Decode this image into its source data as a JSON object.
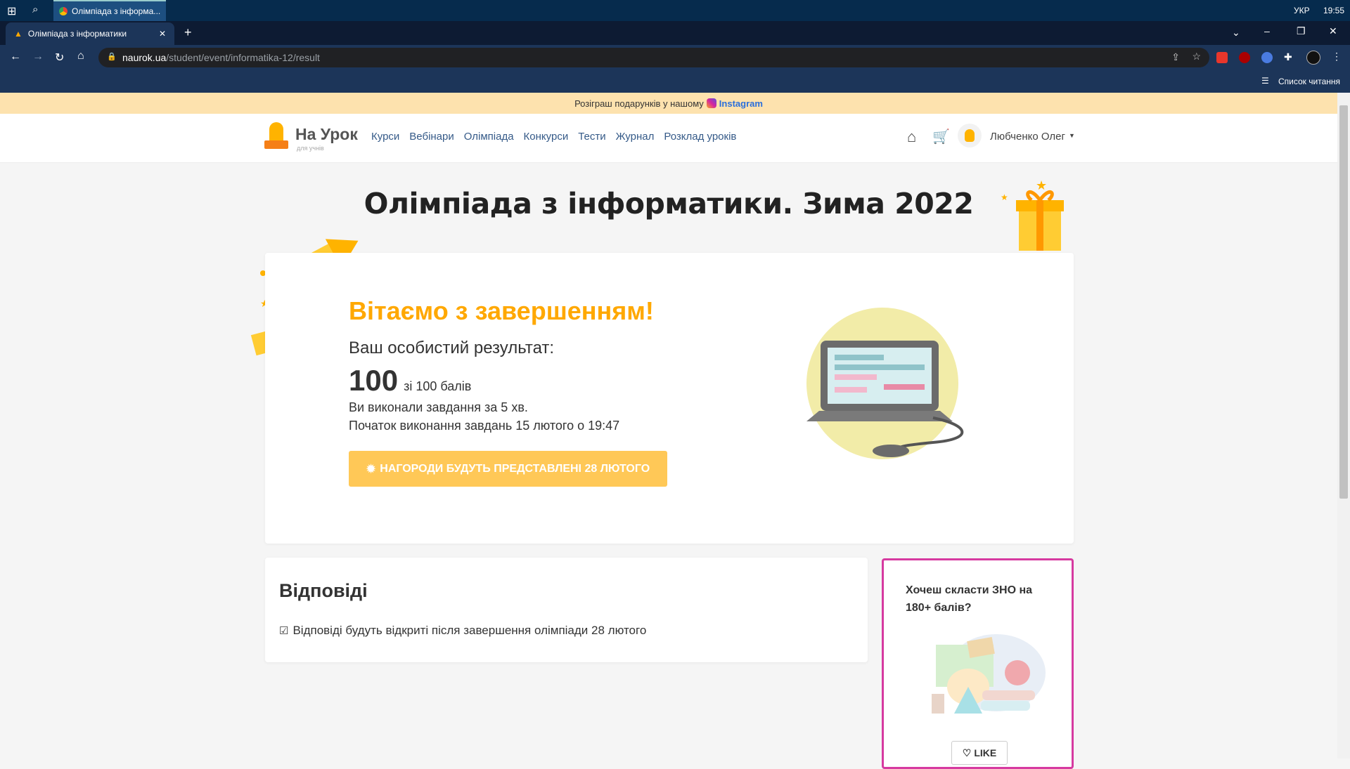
{
  "taskbar": {
    "window_label": "Олімпіада з інформа...",
    "lang": "УКР",
    "time": "19:55"
  },
  "browser": {
    "tab_title": "Олімпіада з інформатики",
    "url_domain": "naurok.ua",
    "url_path": "/student/event/informatika-12/result",
    "reading_list": "Список читання"
  },
  "announce": {
    "text": "Розіграш подарунків у нашому",
    "link": "Instagram"
  },
  "nav": {
    "logo": "На Урок",
    "logo_sub": "для учнів",
    "links": [
      "Курси",
      "Вебінари",
      "Олімпіада",
      "Конкурси",
      "Тести",
      "Журнал",
      "Розклад уроків"
    ],
    "user": "Любченко Олег"
  },
  "page": {
    "title": "Олімпіада з інформатики. Зима 2022"
  },
  "result": {
    "congrats": "Вітаємо з завершенням!",
    "label": "Ваш особистий результат:",
    "score": "100",
    "score_of": "зі 100 балів",
    "duration": "Ви виконали завдання за 5 хв.",
    "start": "Початок виконання завдань 15 лютого о 19:47",
    "award_button": "НАГОРОДИ БУДУТЬ ПРЕДСТАВЛЕНІ 28 ЛЮТОГО"
  },
  "answers": {
    "heading": "Відповіді",
    "note": "Відповіді будуть відкриті після завершення олімпіади 28 лютого"
  },
  "promo": {
    "title": "Хочеш скласти ЗНО на 180+ балів?",
    "like": "LIKE"
  },
  "colors": {
    "accent": "#ffa800",
    "button": "#ffc857",
    "promo_border": "#d63aa0"
  }
}
